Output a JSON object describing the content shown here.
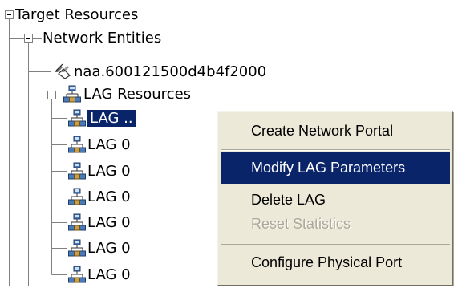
{
  "tree": {
    "root": {
      "label": "Target Resources",
      "expanded": true
    },
    "network_entities": {
      "label": "Network Entities",
      "expanded": true
    },
    "naa_node": {
      "label": "naa.600121500d4b4f2000",
      "icon": "network-storage-icon"
    },
    "lag_resources": {
      "label": "LAG Resources",
      "expanded": true,
      "icon": "network-lan-icon"
    },
    "lag_items": [
      {
        "label": "LAG ..",
        "selected": true,
        "icon": "network-lan-icon"
      },
      {
        "label": "LAG 0",
        "selected": false,
        "icon": "network-lan-icon"
      },
      {
        "label": "LAG 0",
        "selected": false,
        "icon": "network-lan-icon"
      },
      {
        "label": "LAG 0",
        "selected": false,
        "icon": "network-lan-icon"
      },
      {
        "label": "LAG 0",
        "selected": false,
        "icon": "network-lan-icon"
      },
      {
        "label": "LAG 0",
        "selected": false,
        "icon": "network-lan-icon"
      },
      {
        "label": "LAG 0",
        "selected": false,
        "icon": "network-lan-icon"
      }
    ]
  },
  "context_menu": {
    "items": [
      {
        "label": "Create Network Portal",
        "state": "normal"
      },
      {
        "label": "Modify LAG Parameters",
        "state": "highlighted"
      },
      {
        "label": "Delete LAG",
        "state": "normal"
      },
      {
        "label": "Reset Statistics",
        "state": "disabled"
      },
      {
        "label": "Configure Physical Port",
        "state": "normal"
      }
    ]
  },
  "colors": {
    "selection": "#0a246a",
    "menu_background": "#ece9d8",
    "disabled_text": "#aca899",
    "tree_lines": "#808080"
  }
}
